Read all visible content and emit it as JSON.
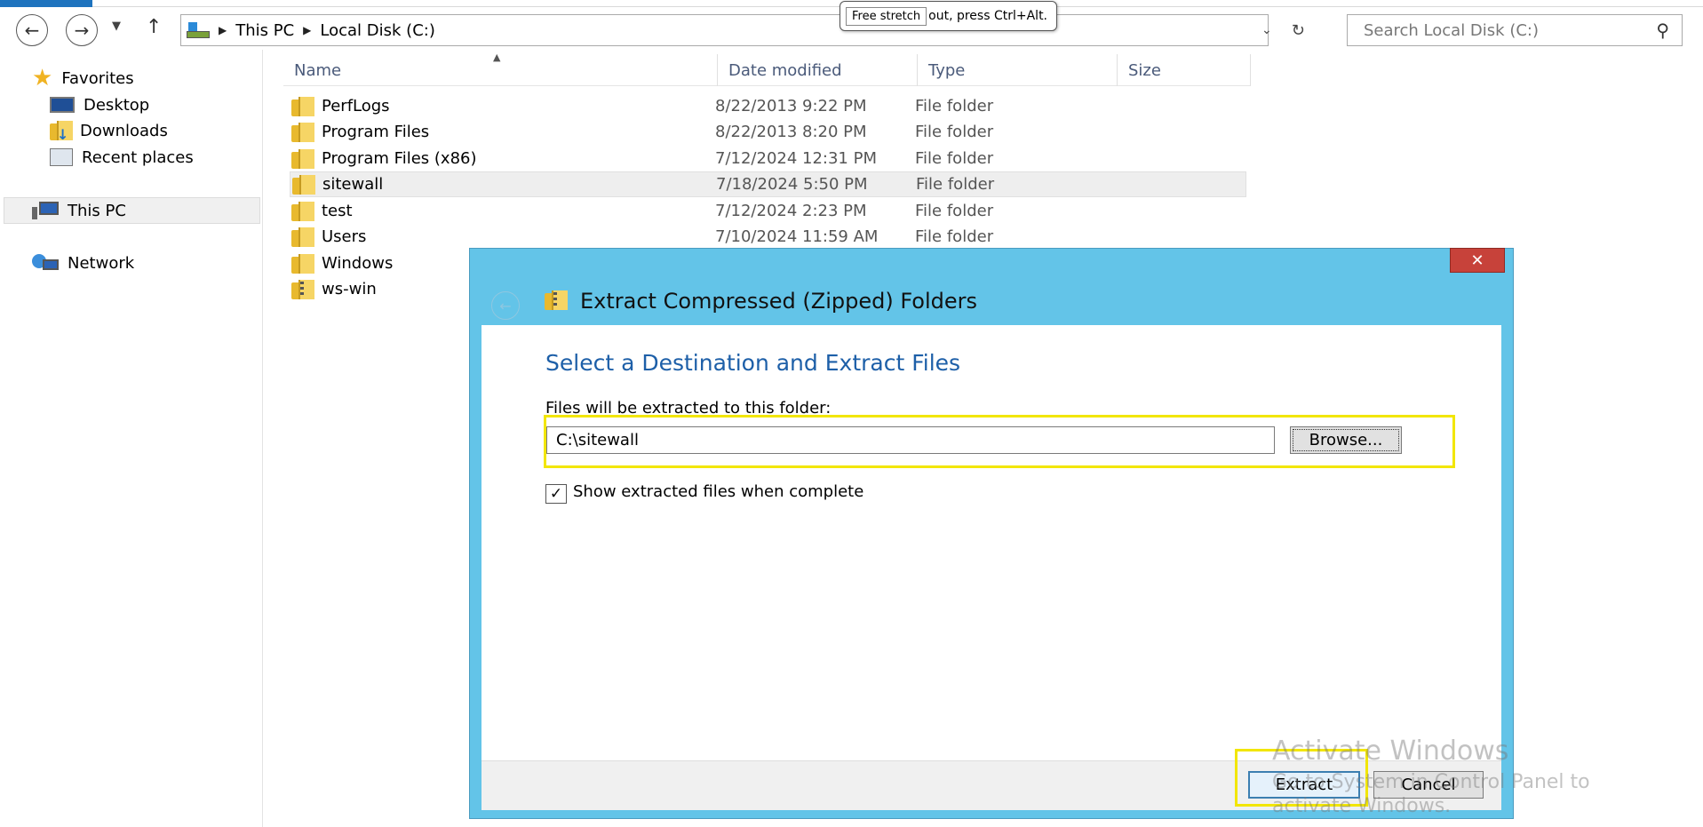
{
  "tooltip": {
    "button_label": "Free stretch",
    "hint": "out, press Ctrl+Alt."
  },
  "address_bar": {
    "crumbs": [
      "This PC",
      "Local Disk (C:)"
    ]
  },
  "search": {
    "placeholder": "Search Local Disk (C:)"
  },
  "sidebar": {
    "favorites": "Favorites",
    "items": [
      {
        "label": "Desktop",
        "icon": "desktop-icon"
      },
      {
        "label": "Downloads",
        "icon": "downloads-icon"
      },
      {
        "label": "Recent places",
        "icon": "recent-places-icon"
      }
    ],
    "this_pc": "This PC",
    "network": "Network"
  },
  "file_list": {
    "columns": [
      "Name",
      "Date modified",
      "Type",
      "Size"
    ],
    "rows": [
      {
        "name": "PerfLogs",
        "date": "8/22/2013 9:22 PM",
        "type": "File folder"
      },
      {
        "name": "Program Files",
        "date": "8/22/2013 8:20 PM",
        "type": "File folder"
      },
      {
        "name": "Program Files (x86)",
        "date": "7/12/2024 12:31 PM",
        "type": "File folder"
      },
      {
        "name": "sitewall",
        "date": "7/18/2024 5:50 PM",
        "type": "File folder"
      },
      {
        "name": "test",
        "date": "7/12/2024 2:23 PM",
        "type": "File folder"
      },
      {
        "name": "Users",
        "date": "7/10/2024 11:59 AM",
        "type": "File folder"
      },
      {
        "name": "Windows",
        "date": "",
        "type": ""
      },
      {
        "name": "ws-win",
        "date": "",
        "type": ""
      }
    ],
    "selected_row": "sitewall"
  },
  "dialog": {
    "title": "Extract Compressed (Zipped) Folders",
    "close_label": "✕",
    "heading": "Select a Destination and Extract Files",
    "folder_label": "Files will be extracted to this folder:",
    "path_value": "C:\\sitewall",
    "browse_label": "Browse...",
    "checkbox_label": "Show extracted files when complete",
    "checkbox_checked": true,
    "extract_label": "Extract",
    "cancel_label": "Cancel",
    "highlight_color": "#f2e600"
  },
  "watermark": {
    "title": "Activate Windows",
    "line1": "Go to System in Control Panel to",
    "line2": "activate Windows."
  }
}
